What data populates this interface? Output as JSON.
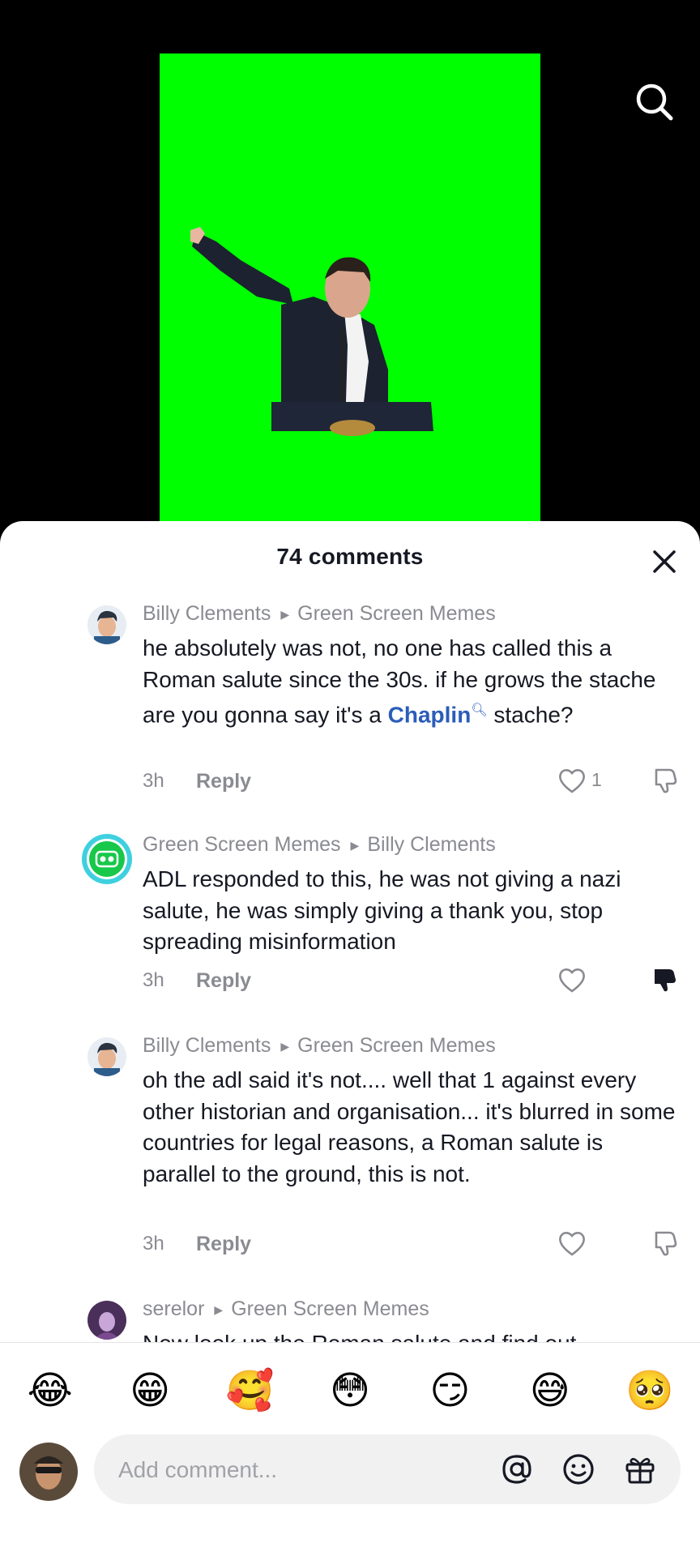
{
  "sheet": {
    "title": "74 comments"
  },
  "comments": [
    {
      "author": "Billy Clements",
      "reply_to": "Green Screen Memes",
      "text_before": "he absolutely was not, no one has called this a Roman salute since the 30s. if he grows the stache are you gonna say it's a ",
      "link": "Chaplin",
      "text_after": " stache?",
      "time": "3h",
      "reply_label": "Reply",
      "likes": "1",
      "disliked": false
    },
    {
      "author": "Green Screen Memes",
      "reply_to": "Billy Clements",
      "text": "ADL responded to this, he was not giving a nazi salute, he was simply giving a thank you, stop spreading misinformation",
      "time": "3h",
      "reply_label": "Reply",
      "likes": "",
      "disliked": true
    },
    {
      "author": "Billy Clements",
      "reply_to": "Green Screen Memes",
      "text": "oh the adl said it's not.... well that 1 against every other historian and organisation... it's blurred in some countries for legal reasons, a Roman salute is parallel to the ground, this is not.",
      "time": "3h",
      "reply_label": "Reply",
      "likes": "",
      "disliked": false
    },
    {
      "author": "serelor",
      "reply_to": "Green Screen Memes",
      "text": "Now look up the Roman salute and find out"
    }
  ],
  "emoji_bar": [
    "😂",
    "😁",
    "🥰",
    "😳",
    "😏",
    "😅",
    "🥺"
  ],
  "composer": {
    "placeholder": "Add comment..."
  },
  "colors": {
    "green_screen": "#00ff00",
    "link": "#2b5db9",
    "muted_text": "#8a8b91",
    "primary_text": "#161823"
  }
}
